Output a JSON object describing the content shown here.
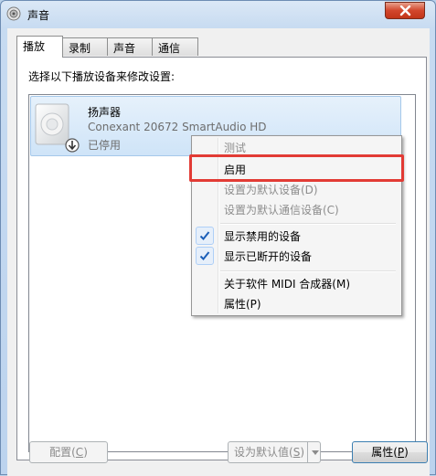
{
  "window": {
    "title": "声音"
  },
  "tabs": [
    {
      "label": "播放",
      "active": true
    },
    {
      "label": "录制",
      "active": false
    },
    {
      "label": "声音",
      "active": false
    },
    {
      "label": "通信",
      "active": false
    }
  ],
  "playback": {
    "instruction": "选择以下播放设备来修改设置:",
    "device": {
      "name": "扬声器",
      "description": "Conexant 20672 SmartAudio HD",
      "status": "已停用"
    }
  },
  "context_menu": {
    "test": "测试",
    "enable": "启用",
    "set_default": "设置为默认设备(D)",
    "set_default_comm": "设置为默认通信设备(C)",
    "show_disabled": "显示禁用的设备",
    "show_disconnected": "显示已断开的设备",
    "about_midi": "关于软件 MIDI 合成器(M)",
    "properties": "属性(P)"
  },
  "buttons": {
    "configure_text": "配置(",
    "configure_key": "C",
    "configure_end": ")",
    "set_default_text": "设为默认值(",
    "set_default_key": "S",
    "set_default_end": ")",
    "properties_text": "属性(",
    "properties_key": "P",
    "properties_end": ")"
  },
  "colors": {
    "highlight": "#e23b35",
    "check": "#1c5fb8"
  }
}
